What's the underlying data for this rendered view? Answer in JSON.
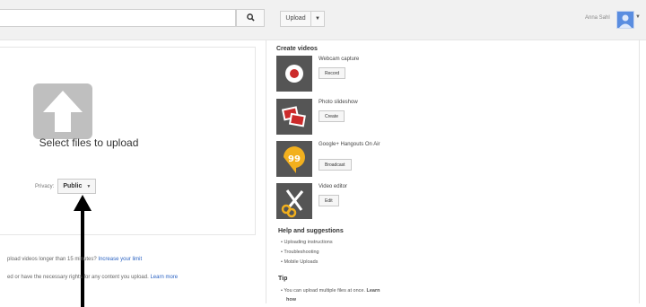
{
  "header": {
    "search_value": "",
    "upload_label": "Upload",
    "user_name": "Anna Sahl",
    "colors": {
      "bar": "#f1f1f1",
      "avatar": "#5a8de0"
    },
    "icons": [
      "search-icon",
      "caret-down-icon",
      "avatar"
    ]
  },
  "upload": {
    "title": "Select files to upload",
    "privacy_label": "Privacy:",
    "privacy_value": "Public"
  },
  "footnotes": {
    "line1_text": "pload videos longer than 15 minutes?",
    "line1_link": "Increase your limit",
    "line2_text": "ed or have the necessary rights for any content you upload.",
    "line2_link": "Learn more"
  },
  "create": {
    "heading": "Create videos",
    "items": [
      {
        "title": "Webcam capture",
        "button": "Record",
        "icon": "webcam-record-icon",
        "color": "#555555"
      },
      {
        "title": "Photo slideshow",
        "button": "Create",
        "icon": "photo-slideshow-icon",
        "color": "#555555"
      },
      {
        "title": "Google+ Hangouts On Air",
        "button": "Broadcast",
        "icon": "hangouts-icon",
        "color": "#555555"
      },
      {
        "title": "Video editor",
        "button": "Edit",
        "icon": "scissors-icon",
        "color": "#555555"
      }
    ]
  },
  "help": {
    "heading": "Help and suggestions",
    "items": [
      "Uploading instructions",
      "Troubleshooting",
      "Mobile Uploads"
    ]
  },
  "tip": {
    "heading": "Tip",
    "text": "You can upload multiple files at once.",
    "link": "Learn",
    "link2": "how"
  }
}
